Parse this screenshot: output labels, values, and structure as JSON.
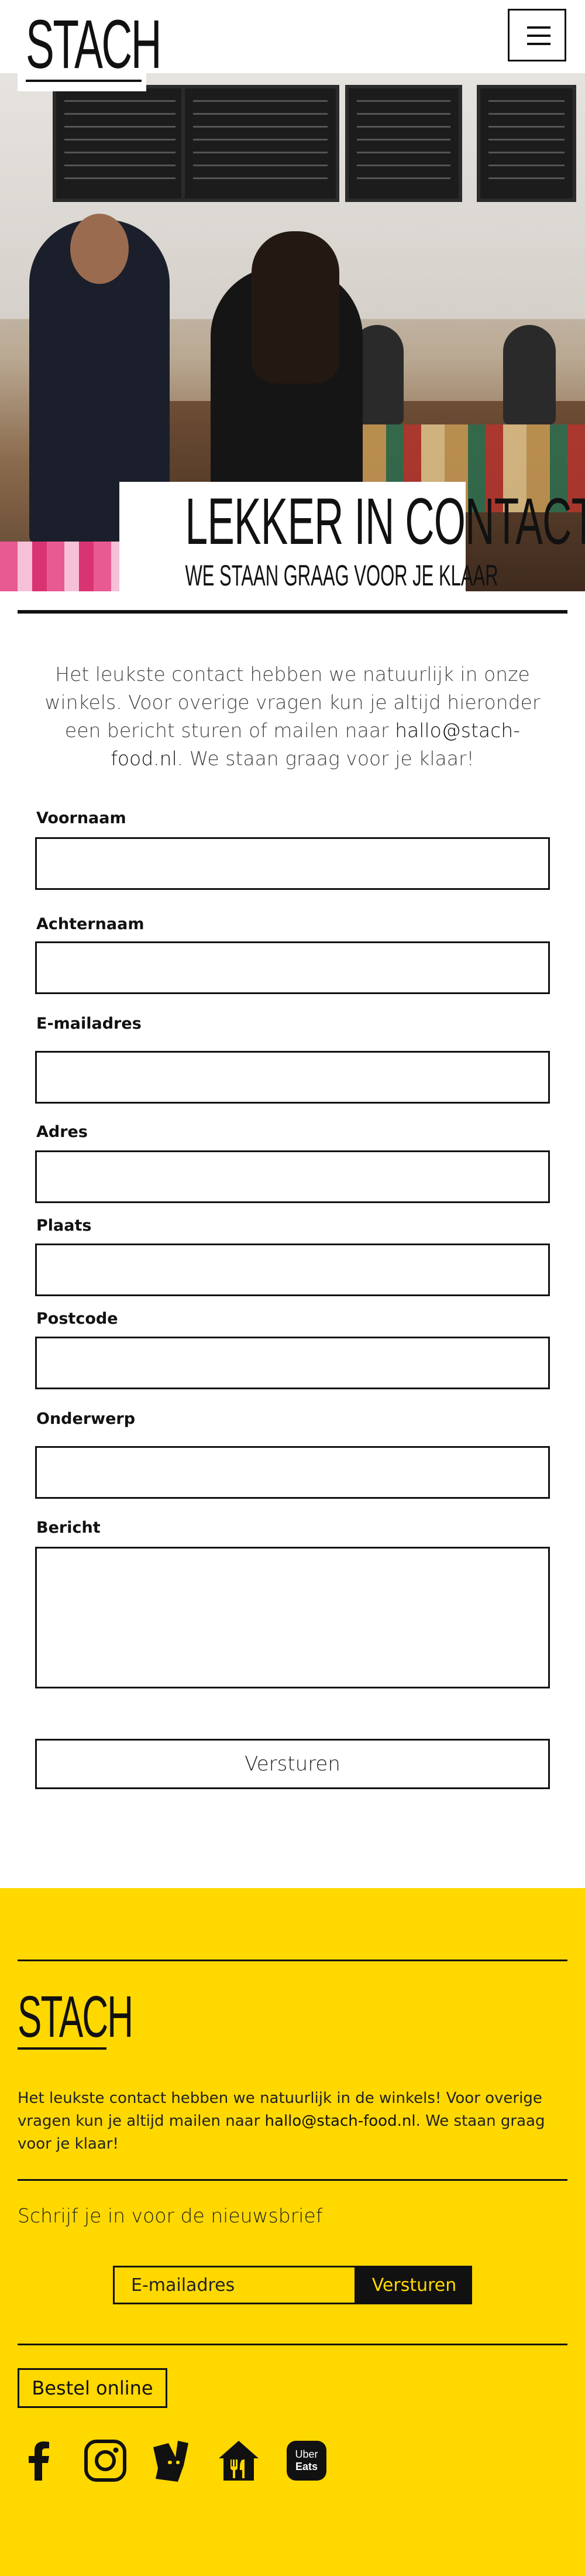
{
  "header": {
    "logo_text": "STACH",
    "menu_icon": "hamburger-menu-icon"
  },
  "hero": {
    "title": "LEKKER IN CONTACT",
    "subtitle": "WE STAAN GRAAG VOOR JE KLAAR"
  },
  "intro": {
    "text_before": "Het leukste contact hebben we natuurlijk in onze winkels. Voor overige vragen kun je altijd hieronder een bericht sturen of mailen naar ",
    "email": "hallo@stach-food.nl",
    "text_after": ". We staan graag voor je klaar!"
  },
  "form": {
    "first_name_label": "Voornaam",
    "last_name_label": "Achternaam",
    "email_label": "E-mailadres",
    "address_label": "Adres",
    "city_label": "Plaats",
    "postcode_label": "Postcode",
    "subject_label": "Onderwerp",
    "message_label": "Bericht",
    "submit_label": "Versturen"
  },
  "footer": {
    "logo_text": "STACH",
    "text_before": "Het leukste contact hebben we natuurlijk in de winkels! Voor overige vragen kun je altijd mailen naar ",
    "email": "hallo@stach-food.nl",
    "text_after": ". We staan graag voor je klaar!",
    "newsletter_title": "Schrijf je in voor de nieuwsbrief",
    "newsletter_placeholder": "E-mailadres",
    "newsletter_button": "Versturen",
    "order_online": "Bestel online",
    "background_color": "#FFD800",
    "socials": [
      "facebook-icon",
      "instagram-icon",
      "deliveroo-icon",
      "thuisbezorgd-icon",
      "uber-eats-icon"
    ],
    "uber_eats_line1": "Uber",
    "uber_eats_line2": "Eats"
  }
}
